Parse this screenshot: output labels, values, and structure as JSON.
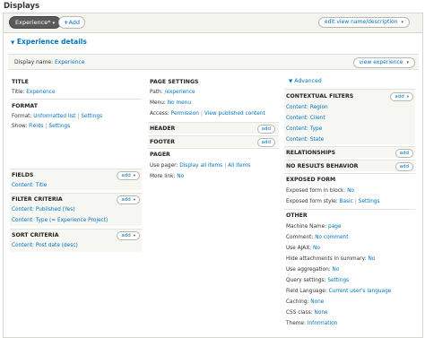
{
  "header": {
    "title": "Displays"
  },
  "tabs": {
    "active": "Experience*",
    "add": "Add",
    "edit_view": "edit view name/description"
  },
  "details": {
    "title": "Experience details",
    "display_name_label": "Display name:",
    "display_name_value": "Experience",
    "view_button": "view experience"
  },
  "colA": {
    "title_h": "TITLE",
    "title_label": "Title:",
    "title_value": "Experience",
    "format_h": "FORMAT",
    "format_label": "Format:",
    "format_value": "Unformatted list",
    "format_settings": "Settings",
    "show_label": "Show:",
    "show_value": "Fields",
    "show_settings": "Settings",
    "fields_h": "FIELDS",
    "fields_add": "add",
    "fields_item": "Content: Title",
    "filter_h": "FILTER CRITERIA",
    "filter_add": "add",
    "filter_items": [
      "Content: Published (Yes)",
      "Content: Type (= Experience Project)"
    ],
    "sort_h": "SORT CRITERIA",
    "sort_add": "add",
    "sort_item": "Content: Post date (desc)"
  },
  "colB": {
    "page_h": "PAGE SETTINGS",
    "path_label": "Path:",
    "path_value": "/experience",
    "menu_label": "Menu:",
    "menu_value": "No menu",
    "access_label": "Access:",
    "access_value": "Permission",
    "access_link": "View published content",
    "header_h": "HEADER",
    "header_add": "add",
    "footer_h": "FOOTER",
    "footer_add": "add",
    "pager_h": "PAGER",
    "use_pager_label": "Use pager:",
    "use_pager_value": "Display all items",
    "use_pager_link": "All items",
    "more_link_label": "More link:",
    "more_link_value": "No"
  },
  "colC": {
    "advanced": "Advanced",
    "ctx_h": "CONTEXTUAL FILTERS",
    "ctx_add": "add",
    "ctx_items": [
      "Content: Region",
      "Content: Client",
      "Content: Type",
      "Content: State"
    ],
    "rel_h": "RELATIONSHIPS",
    "rel_add": "add",
    "nores_h": "NO RESULTS BEHAVIOR",
    "nores_add": "add",
    "exposed_h": "EXPOSED FORM",
    "exposed_block_label": "Exposed form in block:",
    "exposed_block_value": "No",
    "exposed_style_label": "Exposed form style:",
    "exposed_style_value": "Basic",
    "exposed_style_settings": "Settings",
    "other_h": "OTHER",
    "other_rows": [
      {
        "label": "Machine Name:",
        "value": "page"
      },
      {
        "label": "Comment:",
        "value": "No comment"
      },
      {
        "label": "Use AJAX:",
        "value": "No"
      },
      {
        "label": "Hide attachments in summary:",
        "value": "No"
      },
      {
        "label": "Use aggregation:",
        "value": "No"
      },
      {
        "label": "Query settings:",
        "value": "Settings"
      },
      {
        "label": "Field Language:",
        "value": "Current user's language"
      },
      {
        "label": "Caching:",
        "value": "None"
      },
      {
        "label": "CSS class:",
        "value": "None"
      },
      {
        "label": "Theme:",
        "value": "Information"
      }
    ]
  }
}
